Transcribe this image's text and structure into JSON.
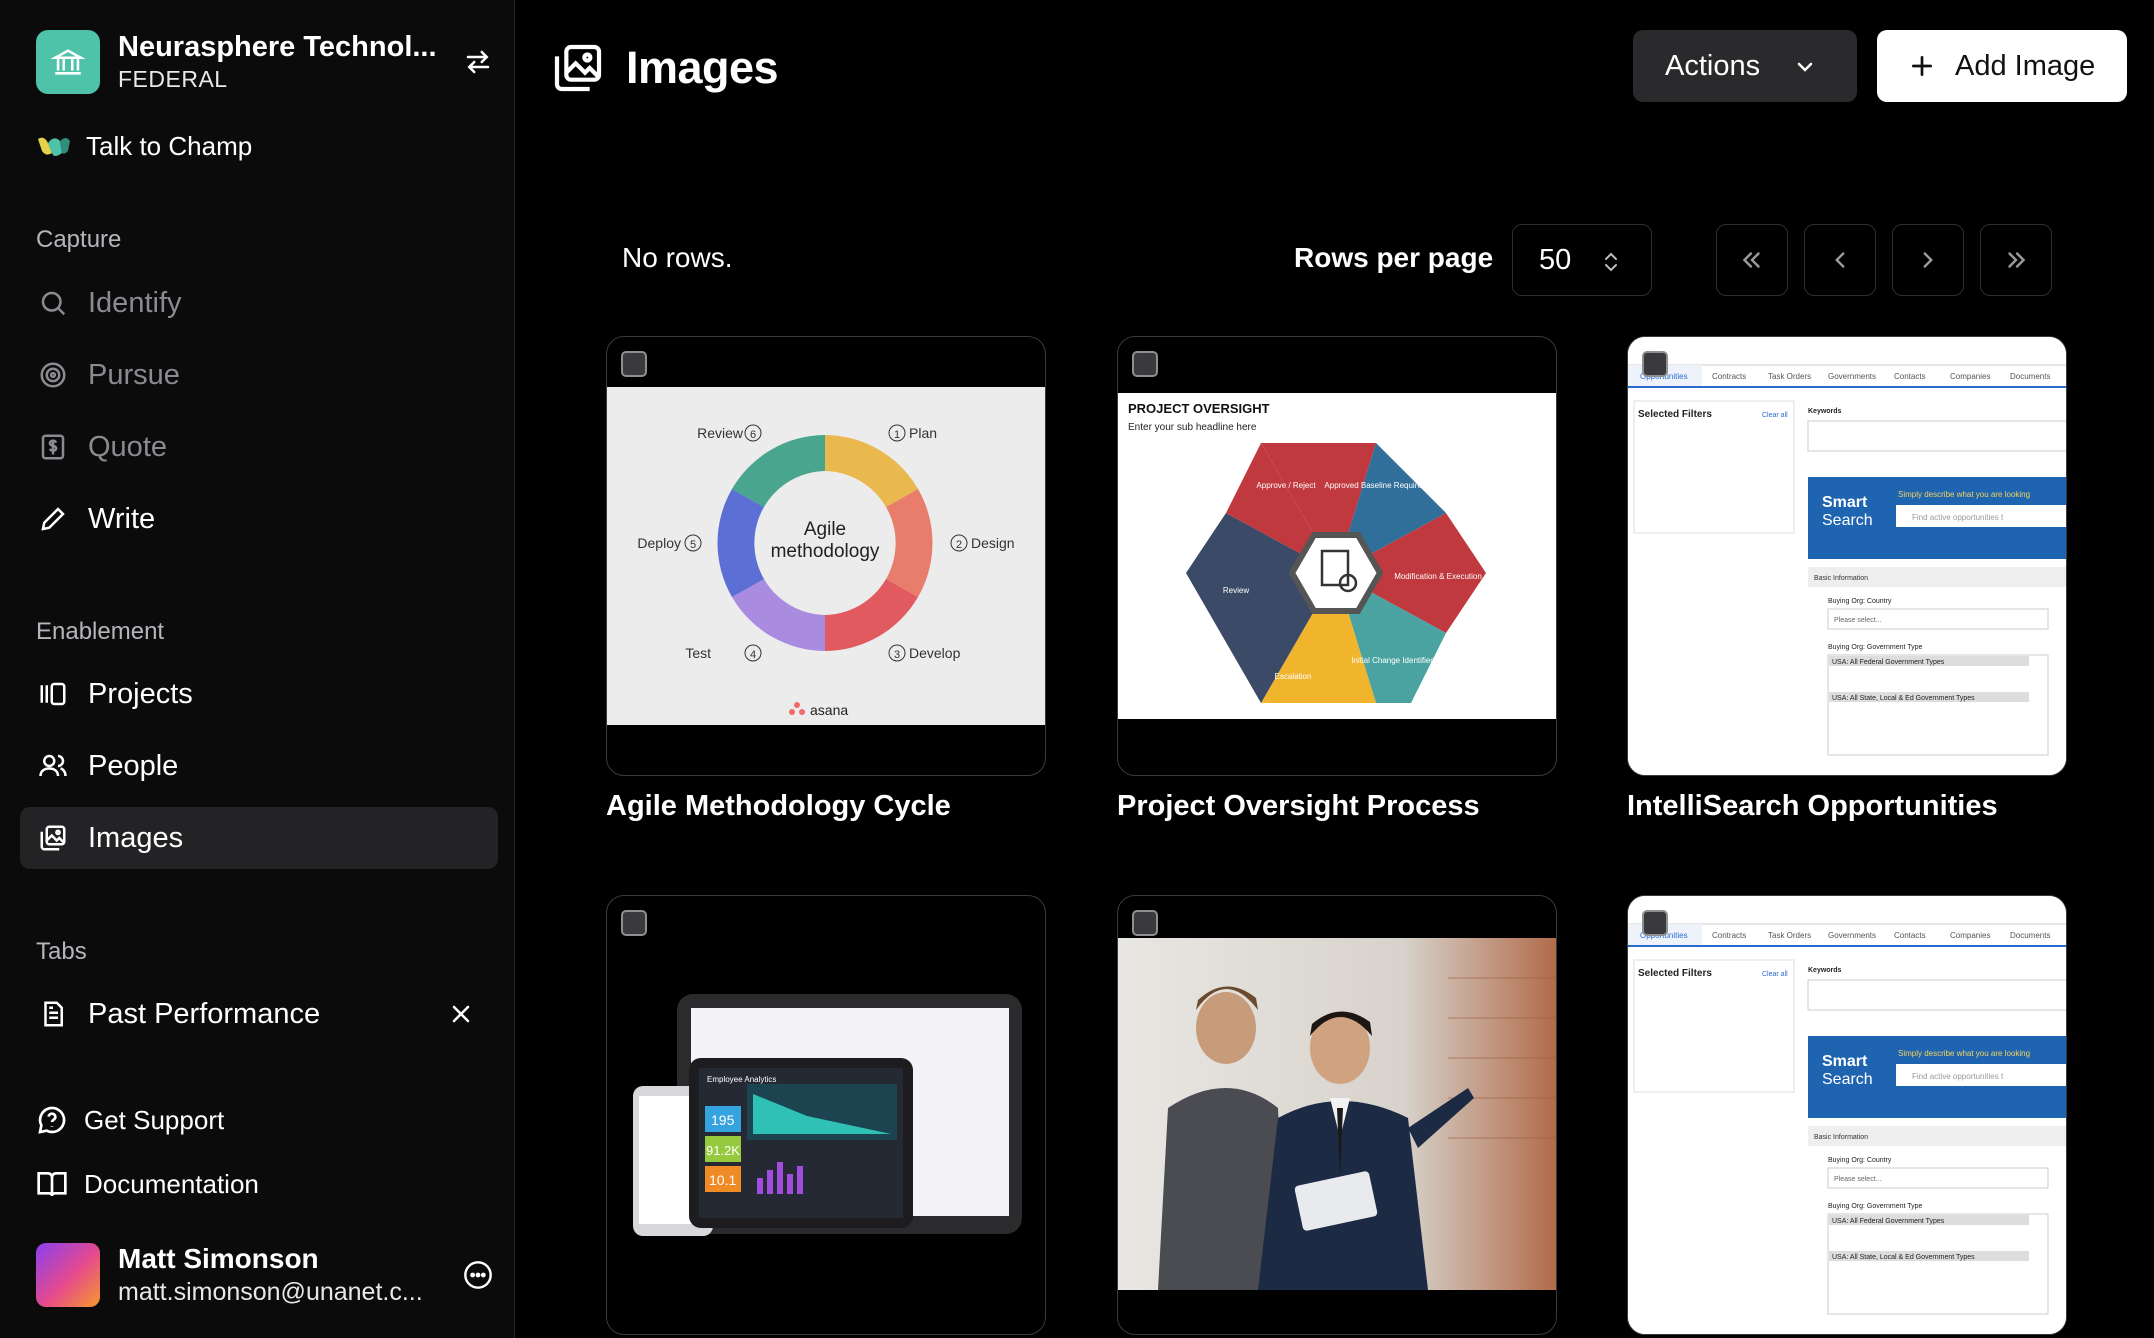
{
  "org": {
    "name": "Neurasphere Technol...",
    "sub": "FEDERAL"
  },
  "champ": {
    "label": "Talk to Champ"
  },
  "sections": {
    "capture": "Capture",
    "enablement": "Enablement",
    "tabs": "Tabs"
  },
  "capture_items": [
    {
      "label": "Identify",
      "icon": "search-icon"
    },
    {
      "label": "Pursue",
      "icon": "target-icon"
    },
    {
      "label": "Quote",
      "icon": "dollar-icon"
    },
    {
      "label": "Write",
      "icon": "pencil-icon"
    }
  ],
  "enablement_items": [
    {
      "label": "Projects",
      "icon": "projects-icon"
    },
    {
      "label": "People",
      "icon": "people-icon"
    },
    {
      "label": "Images",
      "icon": "images-icon"
    }
  ],
  "tab_items": [
    {
      "label": "Past Performance",
      "icon": "document-icon"
    }
  ],
  "bottom": {
    "support": "Get Support",
    "docs": "Documentation"
  },
  "user": {
    "name": "Matt Simonson",
    "email": "matt.simonson@unanet.c..."
  },
  "header": {
    "title": "Images",
    "actions": "Actions",
    "add": "Add Image"
  },
  "table": {
    "no_rows": "No rows.",
    "rows_per_page_label": "Rows per page",
    "rows_per_page": "50"
  },
  "cards": [
    {
      "title": "Agile Methodology Cycle",
      "center1": "Agile",
      "center2": "methodology",
      "steps": [
        "Plan",
        "Design",
        "Develop",
        "Test",
        "Deploy",
        "Review"
      ],
      "nums": [
        "1",
        "2",
        "3",
        "4",
        "5",
        "6"
      ],
      "brand": "asana"
    },
    {
      "title": "Project Oversight Process",
      "heading": "PROJECT OVERSIGHT",
      "sub": "Enter your sub headline here",
      "segments": [
        "Approve / Reject",
        "Approved Baseline Requirements",
        "Modification & Execution",
        "Initial Change Identified",
        "Escalation",
        "Review"
      ]
    },
    {
      "title": "IntelliSearch Opportunities",
      "tabs": [
        "Opportunities",
        "Contracts",
        "Task Orders",
        "Governments",
        "Contacts",
        "Companies",
        "Documents"
      ],
      "filters_title": "Selected Filters",
      "clear": "Clear all",
      "keywords": "Keywords",
      "smart": "Smart",
      "search": "Search",
      "hint": "Simply describe what you are looking",
      "placeholder": "Find active opportunities t",
      "basic": "Basic Information",
      "country": "Buying Org: Country",
      "select": "Please select...",
      "gov_type": "Buying Org: Government Type",
      "usa_fed": "USA: All Federal Government Types",
      "usa_state": "USA: All State, Local & Ed Government Types"
    },
    {
      "title": "",
      "panel_title": "Employee Analytics",
      "stats": [
        "195",
        "91.2K",
        "10.1"
      ]
    },
    {
      "title": ""
    },
    {
      "title": "",
      "tabs": [
        "Opportunities",
        "Contracts",
        "Task Orders",
        "Governments",
        "Contacts",
        "Companies",
        "Documents"
      ],
      "filters_title": "Selected Filters",
      "clear": "Clear all",
      "keywords": "Keywords",
      "smart": "Smart",
      "search": "Search",
      "hint": "Simply describe what you are looking",
      "placeholder": "Find active opportunities t",
      "basic": "Basic Information",
      "country": "Buying Org: Country",
      "select": "Please select...",
      "gov_type": "Buying Org: Government Type",
      "usa_fed": "USA: All Federal Government Types",
      "usa_state": "USA: All State, Local & Ed Government Types"
    }
  ],
  "colors": {
    "accent": "#4fc3a9",
    "sidebar_bg": "#0b0b0c",
    "active_bg": "#232326",
    "agile": [
      "#e9b84e",
      "#e87d6c",
      "#e15a5f",
      "#a98be0",
      "#5c6fd4",
      "#49a58d"
    ],
    "hex": [
      "#c0393f",
      "#2f6f9a",
      "#c0393f",
      "#4aa3a0",
      "#f0b52c",
      "#3b4a66"
    ]
  }
}
